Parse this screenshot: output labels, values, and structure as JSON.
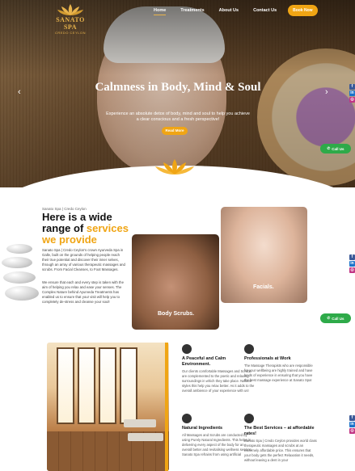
{
  "brand": {
    "name": "SANATO SPA",
    "sub": "CREDO CEYLON"
  },
  "nav": {
    "home": "Home",
    "treatments": "Treatments",
    "about": "About Us",
    "contact": "Contact Us",
    "book": "Book Now"
  },
  "hero": {
    "title": "Calmness in Body, Mind & Soul",
    "subtitle": "Experience an absolute detox of body, mind and soul to help you achieve a clear conscious and a fresh perspective!",
    "cta": "Read More"
  },
  "call": {
    "label": "Call Us"
  },
  "about": {
    "breadcrumb": "Sanato Spa | Credo Ceylon",
    "title_a": "Here is a wide range of ",
    "title_hl": "services we provide",
    "para1": "Sanato Spa | Credo Ceylon's crown Ayurveda Spa in Galle, built on the grounds of helping people reach their true potential and discover their inner selves, through an array of various therapeutic massages and scrubs. From Facial Cleanses, to Foot Massages.",
    "para2": "We ensure that each and every step is taken with the aim of helping you relax and ease your senses. The Complex Nature behind Ayurveda Treatments has enabled us to ensure that your visit will help you to completely de-stress and cleanse your soul!",
    "photo1": "Body Scrubs.",
    "photo2": "Facials."
  },
  "features": [
    {
      "title": "A Peaceful and Calm Environment.",
      "desc": "Our clients comfortable Massages and Scrubs are complemented to the poetic and relaxing surroundings in which they take place. Natural styles this help you relax better. As it adds to the overall ambience of your experience with us!"
    },
    {
      "title": "Professionals at Work",
      "desc": "The Massage Therapists who are responsible for your wellbeing are highly trained and have loads of experience in ensuring that you have the best massage experience at Sanato Spa!"
    },
    {
      "title": "Natural Ingredients",
      "desc": "All Massages and Scrubs are conducted by using Purely Natural Ingredients. This helps in delivering every aspect of the body for an overall better and revitalising wellness session. Sanato Spa refrains from using artificial"
    },
    {
      "title": "The Best Services – at affordable rates!",
      "desc": "Sanato Spa | Credo Ceylon provides world class therapeutic massages and scrubs at an extremely affordable price. This ensures that your body gets the perfect Relaxation it needs, without leaving a dent in your"
    }
  ],
  "colors": {
    "accent": "#f0a514",
    "call": "#2eaa49"
  }
}
